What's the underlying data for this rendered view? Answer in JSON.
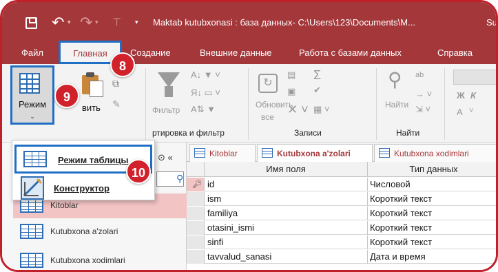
{
  "titlebar": {
    "title": "Maktab kutubxonasi : база данных- C:\\Users\\123\\Documents\\M...",
    "user": "Su"
  },
  "tabs": [
    {
      "label": "Файл"
    },
    {
      "label": "Главная"
    },
    {
      "label": "Создание"
    },
    {
      "label": "Внешние данные"
    },
    {
      "label": "Работа с базами данных"
    },
    {
      "label": "Справка"
    }
  ],
  "ribbon": {
    "mode_label": "Режим",
    "paste_label": "вить",
    "filter_label": "Фильтр",
    "sort_group_label": "ртировка и фильтр",
    "refresh_label": "Обновить",
    "refresh_sub": "все",
    "records_group_label": "Записи",
    "find_label": "Найти",
    "find_group_label": "Найти",
    "format_bold": "Ж",
    "format_italic": "К",
    "font_color": "А"
  },
  "badges": {
    "tab_step": "8",
    "mode_step": "9",
    "menu_step": "10"
  },
  "mode_menu": {
    "items": [
      {
        "label": "Режим таблицы",
        "icon": "datasheet-view-icon"
      },
      {
        "label": "Конструктор",
        "icon": "design-view-icon"
      }
    ]
  },
  "navigation": {
    "items": [
      {
        "label": "Kitoblar"
      },
      {
        "label": "Kutubxona a'zolari"
      },
      {
        "label": "Kutubxona xodimlari"
      }
    ]
  },
  "document_tabs": [
    {
      "label": "Kitoblar"
    },
    {
      "label": "Kutubxona a'zolari"
    },
    {
      "label": "Kutubxona xodimlari"
    }
  ],
  "grid": {
    "col_name_header": "Имя поля",
    "col_type_header": "Тип данных",
    "rows": [
      {
        "name": "id",
        "type": "Числовой"
      },
      {
        "name": "ism",
        "type": "Короткий текст"
      },
      {
        "name": "familiya",
        "type": "Короткий текст"
      },
      {
        "name": "otasini_ismi",
        "type": "Короткий текст"
      },
      {
        "name": "sinfi",
        "type": "Короткий текст"
      },
      {
        "name": "tavvalud_sanasi",
        "type": "Дата и время"
      }
    ]
  },
  "colors": {
    "accent": "#a4373a",
    "highlight_border": "#1f6fc5",
    "badge": "#d1222c",
    "frame": "#c0202a"
  }
}
